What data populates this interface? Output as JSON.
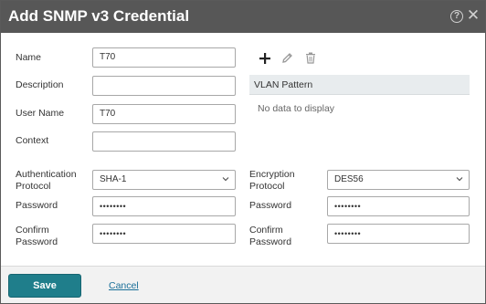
{
  "dialog": {
    "title": "Add SNMP v3 Credential",
    "help_icon": "help-circle-icon",
    "close_icon": "close-icon"
  },
  "form": {
    "name_label": "Name",
    "name_value": "T70",
    "description_label": "Description",
    "description_value": "",
    "username_label": "User Name",
    "username_value": "T70",
    "context_label": "Context",
    "context_value": "",
    "auth_protocol_label_1": "Authentication",
    "auth_protocol_label_2": "Protocol",
    "auth_protocol_value": "SHA-1",
    "auth_password_label": "Password",
    "auth_password_value": "••••••••",
    "auth_confirm_label_1": "Confirm",
    "auth_confirm_label_2": "Password",
    "auth_confirm_value": "••••••••",
    "enc_protocol_label_1": "Encryption",
    "enc_protocol_label_2": "Protocol",
    "enc_protocol_value": "DES56",
    "enc_password_label": "Password",
    "enc_password_value": "••••••••",
    "enc_confirm_label_1": "Confirm",
    "enc_confirm_label_2": "Password",
    "enc_confirm_value": "••••••••"
  },
  "vlan": {
    "toolbar_icons": [
      "plus-icon",
      "pencil-icon",
      "trash-icon"
    ],
    "column_header": "VLAN Pattern",
    "empty_text": "No data to display"
  },
  "footer": {
    "save_label": "Save",
    "cancel_label": "Cancel"
  },
  "colors": {
    "titlebar": "#575757",
    "save_button": "#1f7e8b",
    "link": "#1a6f99"
  }
}
